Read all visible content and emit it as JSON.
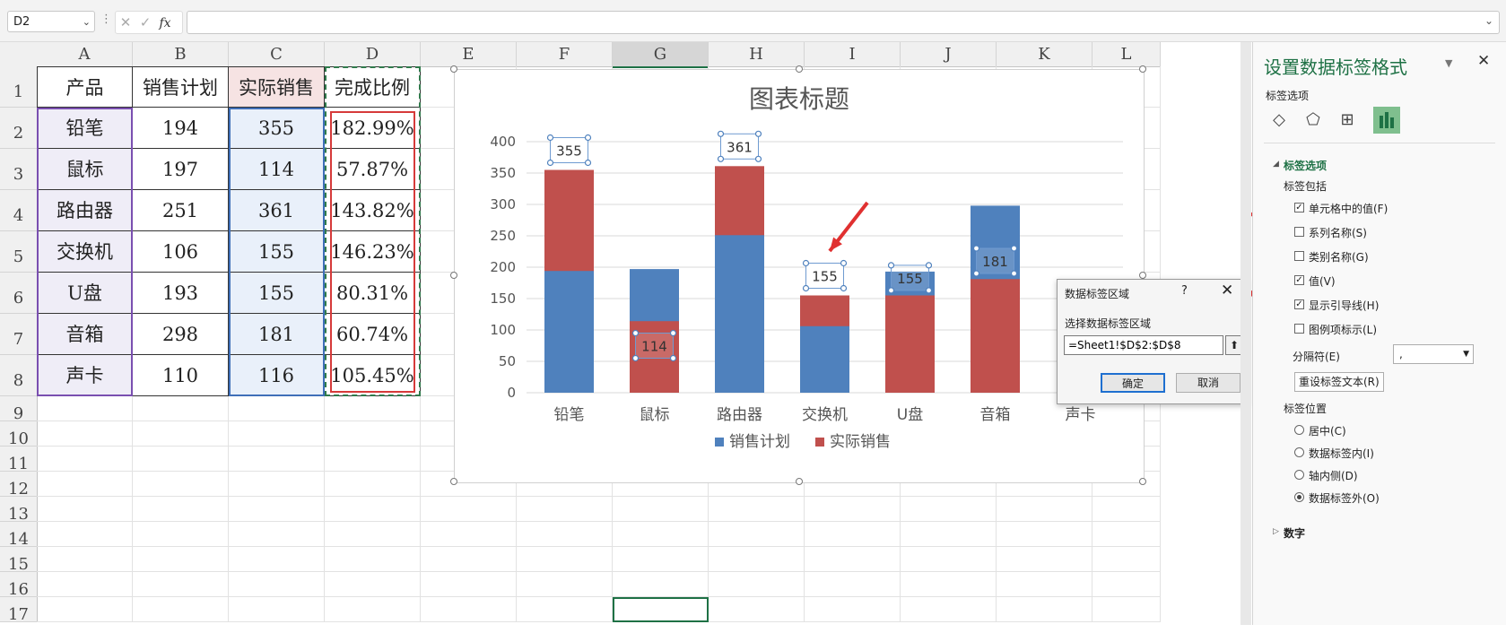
{
  "formula_bar": {
    "name_box": "D2",
    "dots": "⋮",
    "cancel_icon": "✕",
    "enter_icon": "✓",
    "fx_label": "fx",
    "formula": ""
  },
  "sheet": {
    "columns": [
      "A",
      "B",
      "C",
      "D",
      "E",
      "F",
      "G",
      "H",
      "I",
      "J",
      "K",
      "L"
    ],
    "rows": [
      "1",
      "2",
      "3",
      "4",
      "5",
      "6",
      "7",
      "8",
      "9",
      "10",
      "11",
      "12",
      "13",
      "14",
      "15",
      "16",
      "17"
    ],
    "headers": [
      "产品",
      "销售计划",
      "实际销售",
      "完成比例"
    ],
    "data": [
      [
        "铅笔",
        "194",
        "355",
        "182.99%"
      ],
      [
        "鼠标",
        "197",
        "114",
        "57.87%"
      ],
      [
        "路由器",
        "251",
        "361",
        "143.82%"
      ],
      [
        "交换机",
        "106",
        "155",
        "146.23%"
      ],
      [
        "U盘",
        "193",
        "155",
        "80.31%"
      ],
      [
        "音箱",
        "298",
        "181",
        "60.74%"
      ],
      [
        "声卡",
        "110",
        "116",
        "105.45%"
      ]
    ]
  },
  "chart_data": {
    "type": "bar",
    "title": "图表标题",
    "categories": [
      "铅笔",
      "鼠标",
      "路由器",
      "交换机",
      "U盘",
      "音箱",
      "声卡"
    ],
    "series": [
      {
        "name": "销售计划",
        "values": [
          194,
          197,
          251,
          106,
          193,
          298,
          110
        ],
        "color": "#4f81bd"
      },
      {
        "name": "实际销售",
        "values": [
          355,
          114,
          361,
          155,
          155,
          181,
          116
        ],
        "color": "#c0504d"
      }
    ],
    "data_labels": [
      "355",
      "114",
      "361",
      "155",
      "155",
      "181"
    ],
    "ylim": [
      0,
      400
    ],
    "yticks": [
      "0",
      "50",
      "100",
      "150",
      "200",
      "250",
      "300",
      "350",
      "400"
    ],
    "grid": true,
    "legend_position": "bottom"
  },
  "dialog": {
    "title": "数据标签区域",
    "help": "?",
    "close": "✕",
    "label": "选择数据标签区域",
    "value": "=Sheet1!$D$2:$D$8",
    "collapse_icon": "⬆",
    "ok": "确定",
    "cancel": "取消"
  },
  "pane": {
    "title": "设置数据标签格式",
    "caret": "▼",
    "close": "✕",
    "subtitle": "标签选项",
    "tab_icons": [
      "fill-icon",
      "pentagon-icon",
      "size-properties-icon",
      "bar-chart-icon"
    ],
    "section1": "标签选项",
    "section1_arrow": "◢",
    "contains_label": "标签包括",
    "checkboxes": [
      {
        "label": "单元格中的值(F)",
        "checked": true
      },
      {
        "label": "系列名称(S)",
        "checked": false
      },
      {
        "label": "类别名称(G)",
        "checked": false
      },
      {
        "label": "值(V)",
        "checked": true
      },
      {
        "label": "显示引导线(H)",
        "checked": true
      },
      {
        "label": "图例项标示(L)",
        "checked": false
      }
    ],
    "separator_label": "分隔符(E)",
    "separator_value": ",",
    "reset_button": "重设标签文本(R)",
    "position_label": "标签位置",
    "radios": [
      {
        "label": "居中(C)",
        "checked": false
      },
      {
        "label": "数据标签内(I)",
        "checked": false
      },
      {
        "label": "轴内侧(D)",
        "checked": false
      },
      {
        "label": "数据标签外(O)",
        "checked": true
      }
    ],
    "section2": "数字",
    "section2_arrow": "▷"
  },
  "annotation_color": "#e03030"
}
